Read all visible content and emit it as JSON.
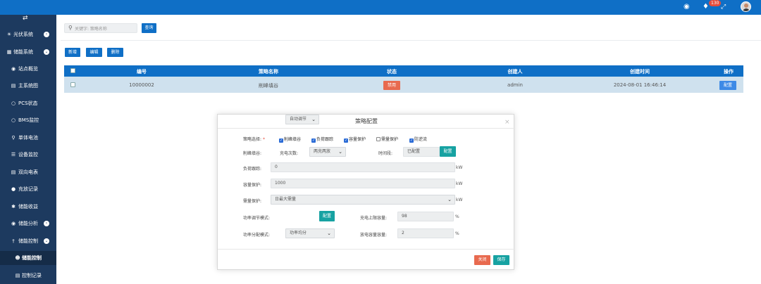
{
  "header": {
    "notification_count": "130",
    "icons": [
      "dashboard-icon",
      "bell-icon",
      "fullscreen-icon",
      "avatar"
    ]
  },
  "sidebar": {
    "toggle_icon": "collapse-icon",
    "items": [
      {
        "label": "光伏系统",
        "icon": "sun-icon",
        "expandable": true
      },
      {
        "label": "储能系统",
        "icon": "battery-icon",
        "expandable": true
      },
      {
        "label": "站点概览",
        "icon": "dashboard-icon"
      },
      {
        "label": "主系统图",
        "icon": "grid-icon"
      },
      {
        "label": "PCS状态",
        "icon": "circle-icon"
      },
      {
        "label": "BMS监控",
        "icon": "circle-icon"
      },
      {
        "label": "单体电池",
        "icon": "pin-icon"
      },
      {
        "label": "设备监控",
        "icon": "list-icon"
      },
      {
        "label": "双向电表",
        "icon": "table-icon"
      },
      {
        "label": "充放记录",
        "icon": "dot-icon"
      },
      {
        "label": "储能收益",
        "icon": "gear-icon"
      },
      {
        "label": "储能分析",
        "icon": "dashboard-icon",
        "expandable": true
      },
      {
        "label": "储能控制",
        "icon": "pin-icon",
        "expandable": true
      },
      {
        "label": "储能控制",
        "icon": "users-icon",
        "active": true
      },
      {
        "label": "控制记录",
        "icon": "table-icon"
      }
    ]
  },
  "search": {
    "placeholder": "关键字: 策略名称",
    "button": "查询"
  },
  "toolbar": {
    "add": "新增",
    "edit": "编辑",
    "delete": "删除"
  },
  "table": {
    "columns": [
      "编号",
      "策略名称",
      "状态",
      "创建人",
      "创建时间",
      "操作"
    ],
    "rows": [
      {
        "id": "10000002",
        "name": "削峰填谷",
        "status": "禁用",
        "creator": "admin",
        "created": "2024-08-01 16:46:14",
        "action": "配置"
      }
    ]
  },
  "modal": {
    "title": "策略配置",
    "strategy_label": "策略选择:",
    "required_mark": "*",
    "strategies": [
      {
        "label": "削峰填谷",
        "checked": true
      },
      {
        "label": "负荷跟踪",
        "checked": true
      },
      {
        "label": "容量保护",
        "checked": true
      },
      {
        "label": "需量保护",
        "checked": false
      },
      {
        "label": "防逆流",
        "checked": true
      }
    ],
    "peak_label": "削峰填谷:",
    "charge_count_label": "充电次数:",
    "charge_count_value": "两充两放",
    "period_label": "时间段:",
    "period_value": "已配置",
    "period_button": "配置",
    "load_label": "负荷跟踪:",
    "load_value": "0",
    "capacity_label": "容量保护:",
    "capacity_value": "1000",
    "demand_label": "需量保护:",
    "demand_value": "日最大需量",
    "unit_kw": "kW",
    "power_mode_label": "功率调节模式:",
    "power_mode_value": "自动调节",
    "power_mode_button": "配置",
    "charge_limit_label": "充电上限容量:",
    "charge_limit_value": "98",
    "alloc_mode_label": "功率分配模式:",
    "alloc_mode_value": "功率均分",
    "discharge_reserve_label": "放电容量容量:",
    "discharge_reserve_value": "2",
    "unit_pct": "%",
    "close": "关闭",
    "save": "保存"
  },
  "colors": {
    "primary": "#0f6fc6",
    "sidebar": "#1d3a5f",
    "danger": "#e86a4f",
    "teal": "#17a2a2",
    "row_selected": "#cfe1ee"
  }
}
